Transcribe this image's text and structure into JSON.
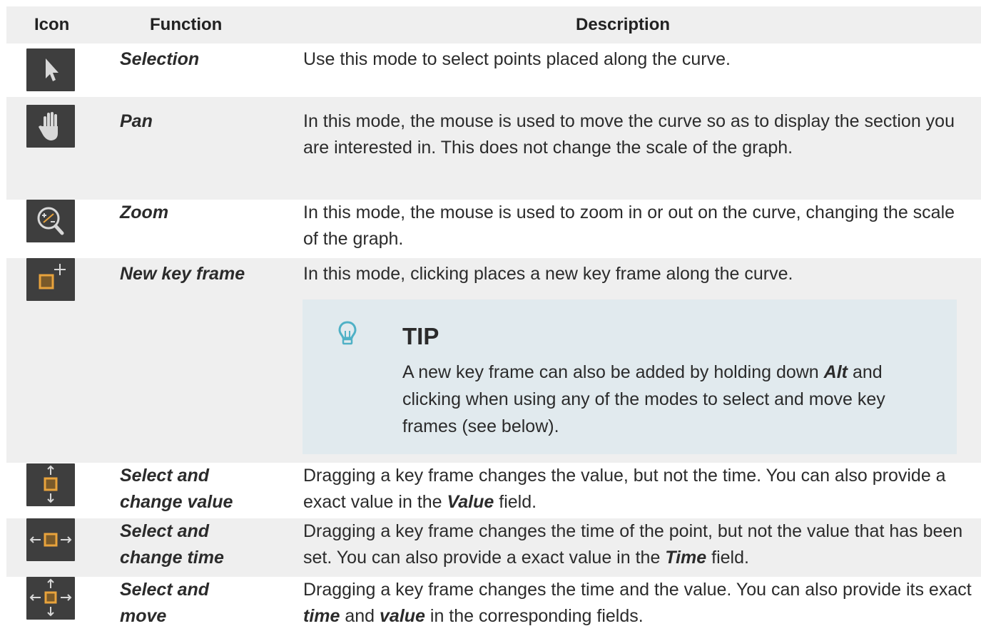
{
  "headers": {
    "icon": "Icon",
    "function": "Function",
    "description": "Description"
  },
  "rows": [
    {
      "icon": "selection-arrow-icon",
      "function": "Selection",
      "description": "Use this mode to select points placed along the curve."
    },
    {
      "icon": "pan-hand-icon",
      "function": "Pan",
      "description": "In this mode, the mouse is used to move the curve so as to display the section you are interested in. This does not change the scale of the graph."
    },
    {
      "icon": "zoom-magnifier-icon",
      "function": "Zoom",
      "description": "In this mode, the mouse is used to zoom in or out on the curve, changing the scale of the graph."
    },
    {
      "icon": "new-key-frame-icon",
      "function": "New key frame",
      "description": "In this mode, clicking places a new key frame along the curve."
    },
    {
      "icon": "change-value-icon",
      "function_line1": "Select and",
      "function_line2": "change value",
      "description_before": "Dragging a key frame changes the value, but not the time. You can also provide a exact value in the ",
      "description_bold": "Value",
      "description_after": " field."
    },
    {
      "icon": "change-time-icon",
      "function_line1": "Select and",
      "function_line2": "change time",
      "description_before": "Dragging a key frame changes the time of the point, but not the value that has been set. You can also provide a exact value in the ",
      "description_bold": "Time",
      "description_after": " field."
    },
    {
      "icon": "move-key-frame-icon",
      "function_line1": "Select and",
      "function_line2": "move",
      "description_before": "Dragging a key frame changes the time and the value. You can also provide its exact ",
      "description_bold1": "time",
      "description_middle": " and ",
      "description_bold2": "value",
      "description_after": " in the corresponding fields."
    }
  ],
  "tip": {
    "icon": "lightbulb-icon",
    "title": "TIP",
    "text_before": "A new key frame can also be added by holding down ",
    "text_bold": "Alt",
    "text_after": " and clicking when using any of the modes to select and move key frames (see below)."
  },
  "colors": {
    "icon_tile_bg": "#3e3e3e",
    "keyframe_orange": "#e8a33c",
    "row_shade": "#efefef",
    "tip_bg": "#e1eaee",
    "tip_icon": "#4fb1c6"
  }
}
